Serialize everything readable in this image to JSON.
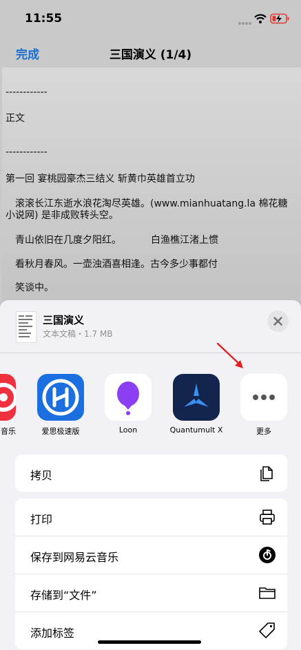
{
  "status_bar": {
    "time": "11:55"
  },
  "nav": {
    "done_label": "完成",
    "title": "三国演义 (1/4)"
  },
  "document": {
    "lines": [
      "------------",
      "正文",
      "------------",
      "第一回 宴桃园豪杰三结义 斩黄巾英雄首立功",
      "滚滚长江东逝水浪花淘尽英雄。(www.mianhuatang.la 棉花糖",
      "小说网) 是非成败转头空。",
      "青山依旧在几度夕阳红。",
      "白渔樵江渚上惯",
      "看秋月春风。一壶浊酒喜相逢。古今多少事都付",
      "笑谈中。"
    ]
  },
  "share_sheet": {
    "file_name": "三国演义",
    "file_meta": "文本文稿・1.7 MB",
    "apps": [
      {
        "label": "音乐",
        "icon": "music-app-icon",
        "color": "#e8303c"
      },
      {
        "label": "爱思极速版",
        "icon": "aisi-app-icon",
        "color": "#1a73e8"
      },
      {
        "label": "Loon",
        "icon": "loon-balloon-icon",
        "color": "#8a3ff0"
      },
      {
        "label": "Quantumult X",
        "icon": "quantumult-x-icon",
        "color": "#14285a"
      },
      {
        "label": "更多",
        "icon": "more-dots-icon",
        "color": "#ffffff"
      }
    ],
    "actions_group1": [
      {
        "label": "拷贝",
        "icon": "copy-icon"
      }
    ],
    "actions_group2": [
      {
        "label": "打印",
        "icon": "printer-icon"
      },
      {
        "label": "保存到网易云音乐",
        "icon": "netease-music-icon"
      },
      {
        "label": "存储到“文件”",
        "icon": "folder-icon"
      },
      {
        "label": "添加标签",
        "icon": "tag-icon"
      }
    ]
  }
}
